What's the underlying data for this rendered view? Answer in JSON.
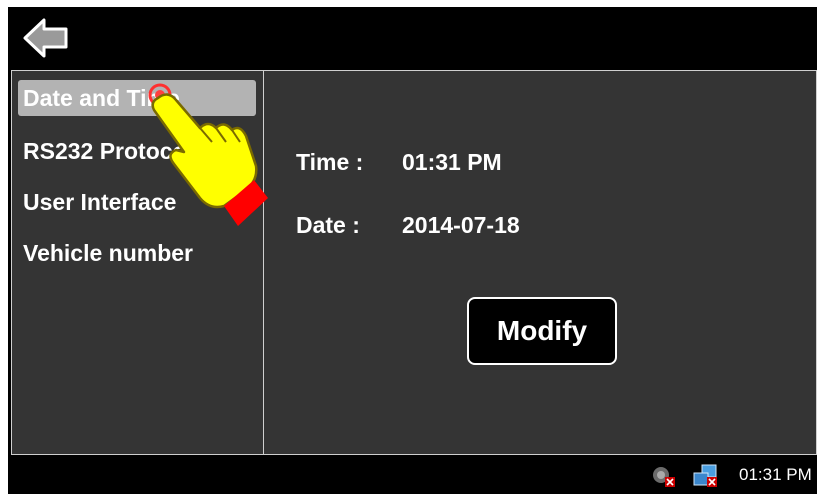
{
  "sidebar": {
    "items": [
      {
        "label": "Date and Time",
        "selected": true
      },
      {
        "label": "RS232 Protocol",
        "selected": false
      },
      {
        "label": "User Interface",
        "selected": false
      },
      {
        "label": "Vehicle number",
        "selected": false
      }
    ]
  },
  "main": {
    "time_label": "Time :",
    "time_value": "01:31 PM",
    "date_label": "Date :",
    "date_value": "2014-07-18",
    "modify_label": "Modify"
  },
  "taskbar": {
    "clock": "01:31 PM"
  },
  "colors": {
    "panel_bg": "#343434",
    "selected_bg": "#b3b3b3",
    "hand_fill": "#ffff00",
    "cuff": "#ff0000"
  },
  "icons": [
    "back-arrow-icon",
    "settings-disconnected-icon",
    "network-disconnected-icon",
    "pointer-hand-icon"
  ]
}
